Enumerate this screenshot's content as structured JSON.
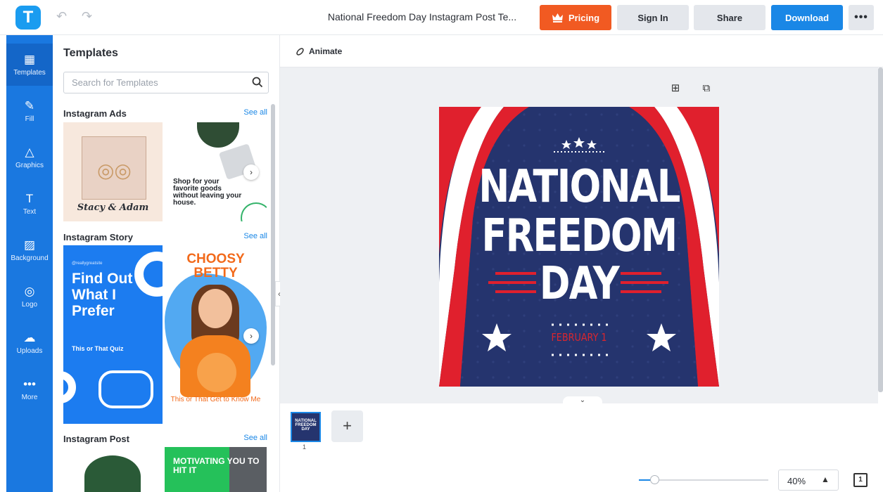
{
  "header": {
    "logo_letter": "T",
    "undo_icon": "↶",
    "redo_icon": "↷",
    "doc_title": "National Freedom Day Instagram Post Te...",
    "pricing_label": "Pricing",
    "signin_label": "Sign In",
    "share_label": "Share",
    "download_label": "Download",
    "more_label": "•••"
  },
  "rail": {
    "items": [
      {
        "label": "Templates",
        "icon": "▦"
      },
      {
        "label": "Fill",
        "icon": "✎"
      },
      {
        "label": "Graphics",
        "icon": "△"
      },
      {
        "label": "Text",
        "icon": "T"
      },
      {
        "label": "Background",
        "icon": "▨"
      },
      {
        "label": "Logo",
        "icon": "◎"
      },
      {
        "label": "Uploads",
        "icon": "☁"
      },
      {
        "label": "More",
        "icon": "•••"
      }
    ]
  },
  "panel": {
    "title": "Templates",
    "search_placeholder": "Search for Templates",
    "see_all": "See all",
    "sections": [
      {
        "title": "Instagram Ads"
      },
      {
        "title": "Instagram Story"
      },
      {
        "title": "Instagram Post"
      }
    ],
    "cards": {
      "ads_1_names": "Stacy & Adam",
      "ads_2_text": "Shop for your favorite goods without leaving your house.",
      "story_1_handle": "@reallygreatsite",
      "story_1_big": "Find Out What I Prefer",
      "story_1_small": "This or That Quiz",
      "story_2_title": "CHOOSY BETTY",
      "story_2_foot": "This or That Get to Know Me",
      "post_2_text": "MOTIVATING YOU TO HIT IT"
    }
  },
  "editor": {
    "animate_label": "Animate",
    "add_icon": "⊞",
    "duplicate_icon": "⧉"
  },
  "poster": {
    "line1": "NATIONAL",
    "line2": "FREEDOM",
    "line3": "DAY",
    "date": "FEBRUARY 1",
    "colors": {
      "navy": "#25346e",
      "red": "#e0202d",
      "white": "#ffffff"
    }
  },
  "pages": {
    "thumb_text": "NATIONAL FREEDOM DAY",
    "page_number": "1",
    "add_label": "+"
  },
  "footer": {
    "zoom_value": "40%",
    "zoom_level": 0.12,
    "zoom_caret": "▲",
    "pages_icon_label": "1"
  }
}
